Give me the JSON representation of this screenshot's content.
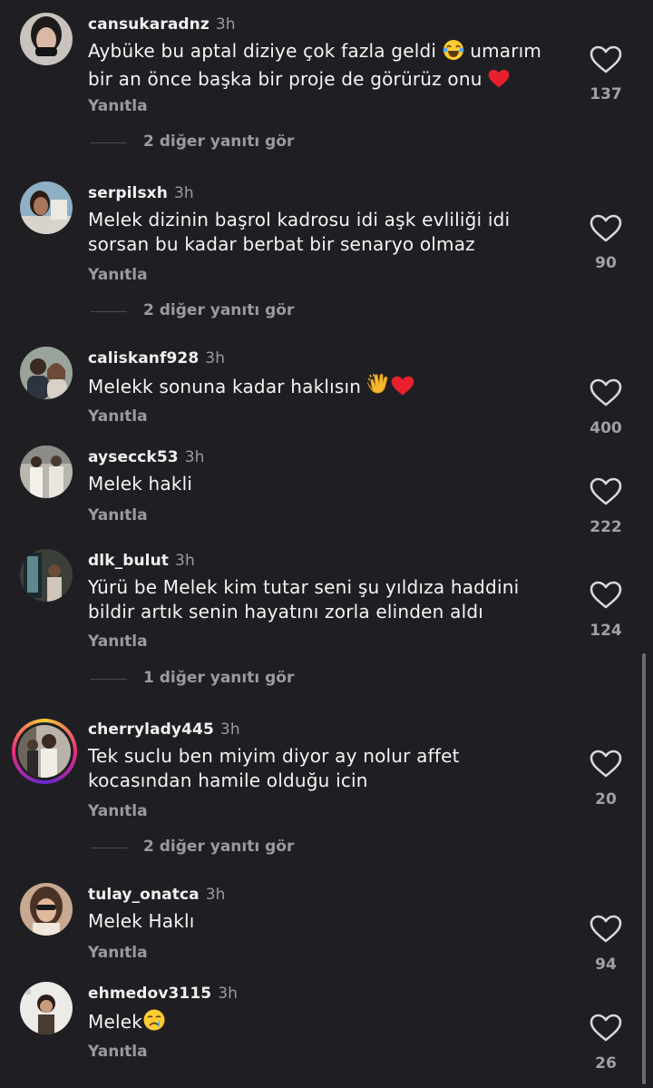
{
  "reply_label": "Yanıtla",
  "comments": [
    {
      "user": "cansukaradnz",
      "time": "3h",
      "text_a": "Aybüke bu aptal diziye çok fazla geldi",
      "text_b": "umarım",
      "text_c": "bir an önce başka bir proje de görürüz onu",
      "likes": "137",
      "more": "2 diğer yanıtı gör"
    },
    {
      "user": "serpilsxh",
      "time": "3h",
      "text_a": "Melek dizinin başrol kadrosu idi aşk evliliği idi",
      "text_c": "sorsan bu kadar berbat bir senaryo olmaz",
      "likes": "90",
      "more": "2 diğer yanıtı gör"
    },
    {
      "user": "caliskanf928",
      "time": "3h",
      "text_a": "Melekk sonuna kadar haklısın",
      "likes": "400"
    },
    {
      "user": "aysecck53",
      "time": "3h",
      "text_a": "Melek hakli",
      "likes": "222"
    },
    {
      "user": "dlk_bulut",
      "time": "3h",
      "text_a": "Yürü be Melek kim tutar seni şu yıldıza haddini",
      "text_c": "bildir artık senin hayatını zorla elinden aldı",
      "likes": "124",
      "more": "1 diğer yanıtı gör"
    },
    {
      "user": "cherrylady445",
      "time": "3h",
      "text_a": "Tek suclu ben miyim diyor ay nolur affet",
      "text_c": "kocasından hamile olduğu icin",
      "likes": "20",
      "more": "2 diğer yanıtı gör"
    },
    {
      "user": "tulay_onatca",
      "time": "3h",
      "text_a": "Melek Haklı",
      "likes": "94"
    },
    {
      "user": "ehmedov3115",
      "time": "3h",
      "text_a": "Melek",
      "likes": "26"
    }
  ]
}
